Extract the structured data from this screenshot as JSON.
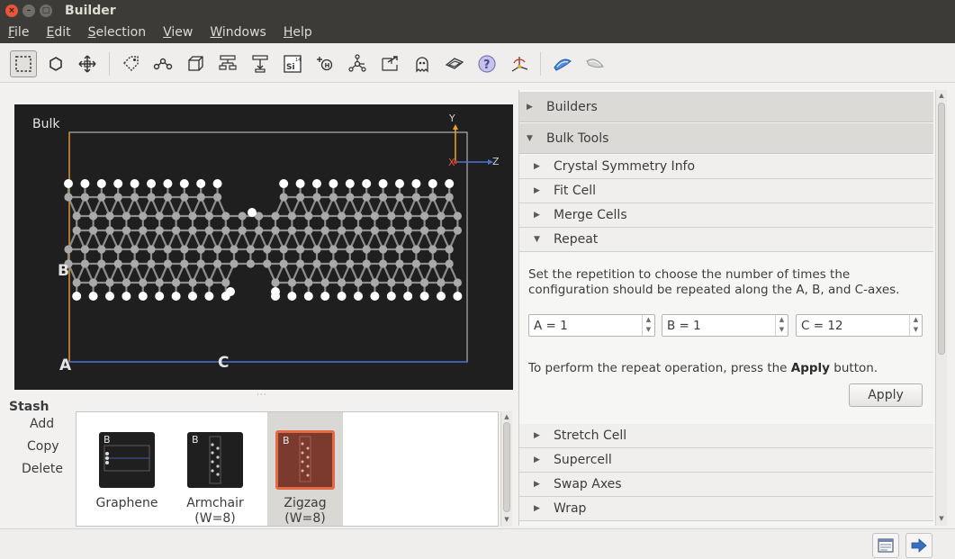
{
  "window": {
    "title": "Builder",
    "controls": [
      "close-icon",
      "minimize-icon",
      "maximize-icon"
    ]
  },
  "menu": [
    {
      "label": "File",
      "mnemonic": "F"
    },
    {
      "label": "Edit",
      "mnemonic": "E"
    },
    {
      "label": "Selection",
      "mnemonic": "S"
    },
    {
      "label": "View",
      "mnemonic": "V"
    },
    {
      "label": "Windows",
      "mnemonic": "W"
    },
    {
      "label": "Help",
      "mnemonic": "H"
    }
  ],
  "toolbar": {
    "tools": [
      "select-rectangle-icon",
      "hexagon-icon",
      "move-icon",
      "tag-icon",
      "chain-icon",
      "cube-icon",
      "tree-icon",
      "tree-down-icon",
      "element-si-icon",
      "atom-h-icon",
      "molecule-icon",
      "export-arrow-icon",
      "ghost-icon",
      "plane-icon",
      "help-circle-icon",
      "axes-icon",
      "bond-blue-icon",
      "bond-grey-icon"
    ],
    "si_symbol": "Si",
    "si_number": "14",
    "h_symbol": "H"
  },
  "viewer": {
    "label": "Bulk",
    "axis_a": "A",
    "axis_b": "B",
    "axis_c": "C",
    "mini_y": "Y",
    "mini_x": "X",
    "mini_z": "Z",
    "colors": {
      "background": "#1f1f1f",
      "carbon": "#a9a9a9",
      "hydrogen": "#ffffff",
      "cell_orange": "#d8913e",
      "cell_blue": "#4a72d6"
    }
  },
  "stash": {
    "title": "Stash",
    "actions": {
      "add": "Add",
      "copy": "Copy",
      "delete": "Delete"
    },
    "items": [
      {
        "name": "Graphene",
        "badge": "B",
        "selected": false
      },
      {
        "name": "Armchair",
        "sub": "(W=8)",
        "badge": "B",
        "selected": false
      },
      {
        "name": "Zigzag",
        "sub": "(W=8)",
        "badge": "B",
        "selected": true
      }
    ]
  },
  "panel": {
    "builders": "Builders",
    "bulk_tools": "Bulk Tools",
    "tools": {
      "crystal": "Crystal Symmetry Info",
      "fit": "Fit Cell",
      "merge": "Merge Cells",
      "repeat": "Repeat",
      "stretch": "Stretch Cell",
      "supercell": "Supercell",
      "swap": "Swap Axes",
      "wrap": "Wrap"
    },
    "repeat": {
      "description": "Set the repetition to choose the number of times the configuration should be repeated along the A, B, and C-axes.",
      "a_value": "A = 1",
      "b_value": "B = 1",
      "c_value": "C = 12",
      "hint_prefix": "To perform the repeat operation, press the ",
      "hint_bold": "Apply",
      "hint_suffix": " button.",
      "apply_label": "Apply"
    }
  },
  "status": {
    "buttons": [
      "log-window-icon",
      "send-arrow-icon"
    ]
  }
}
